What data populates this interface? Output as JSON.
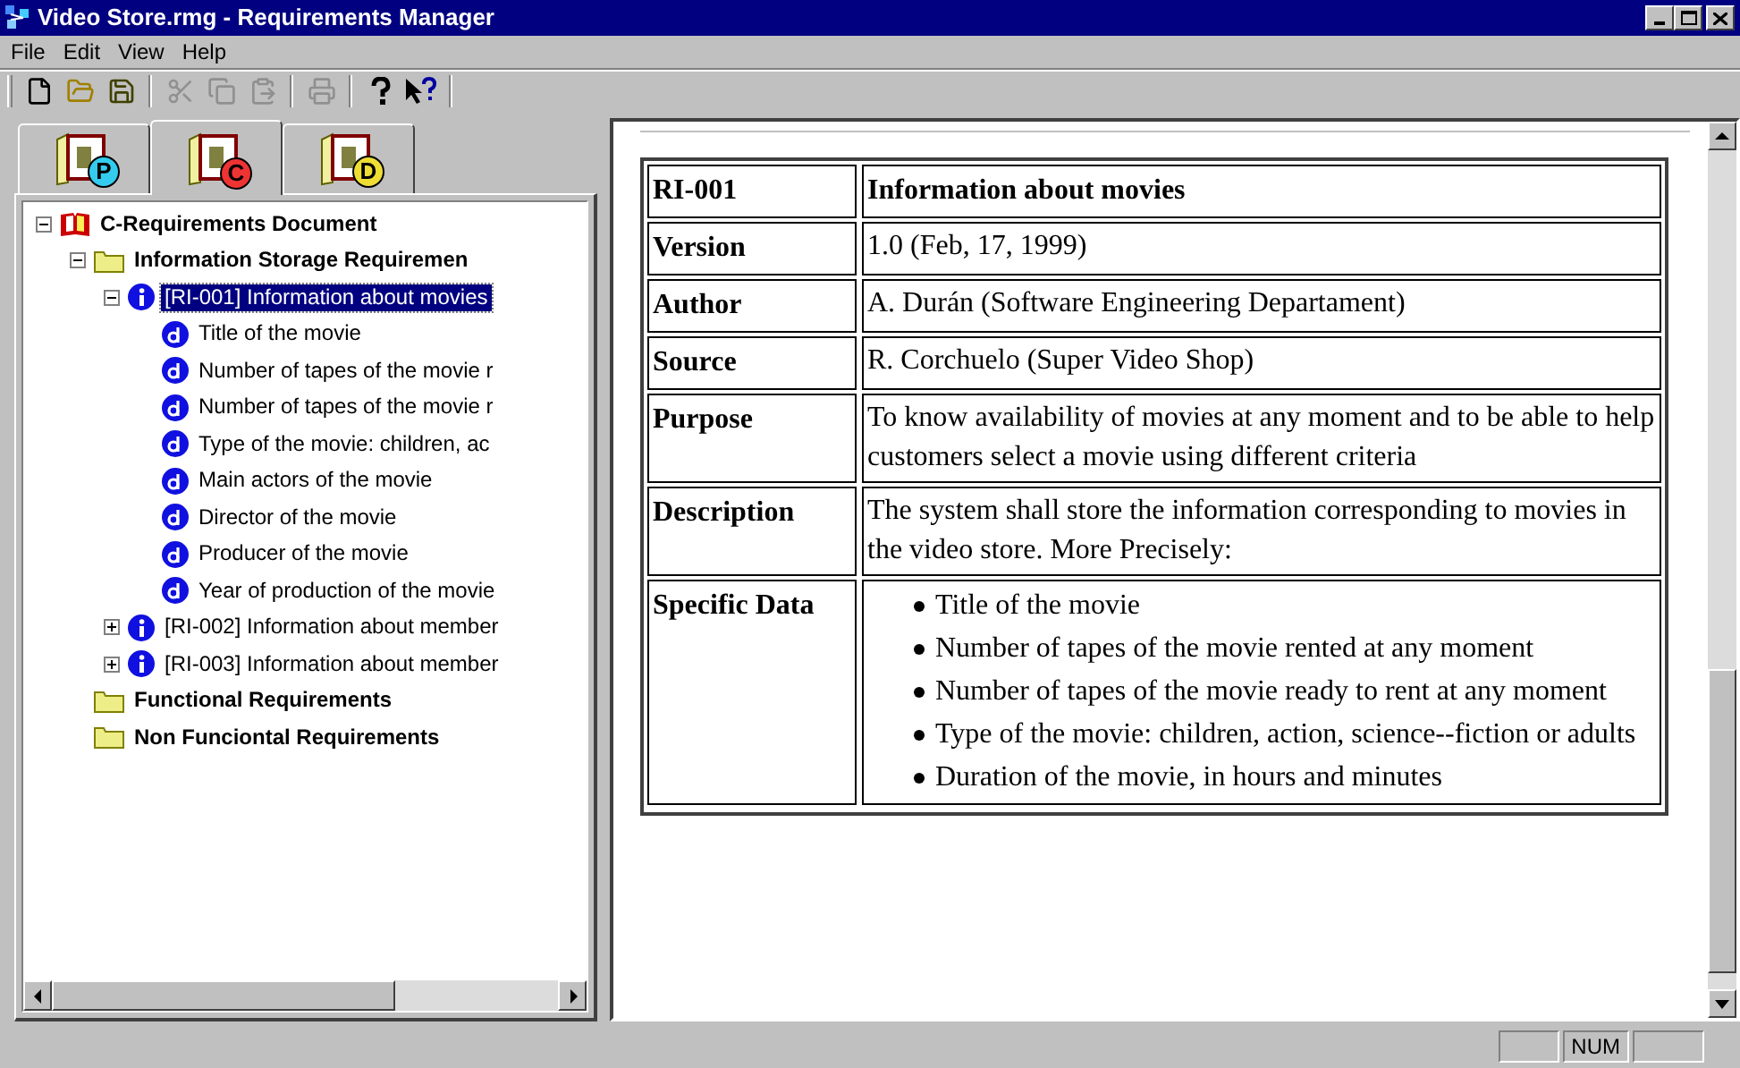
{
  "window": {
    "title": "Video Store.rmg - Requirements Manager"
  },
  "menu": [
    "File",
    "Edit",
    "View",
    "Help"
  ],
  "toolbar": [
    [
      {
        "kind": "new",
        "disabled": false
      },
      {
        "kind": "open",
        "disabled": false
      },
      {
        "kind": "save",
        "disabled": false
      }
    ],
    [
      {
        "kind": "cut",
        "disabled": true
      },
      {
        "kind": "copy",
        "disabled": true
      },
      {
        "kind": "paste",
        "disabled": true
      }
    ],
    [
      {
        "kind": "print",
        "disabled": true
      }
    ],
    [
      {
        "kind": "help",
        "disabled": false
      },
      {
        "kind": "context-help",
        "disabled": false
      }
    ]
  ],
  "tabs": [
    {
      "letter": "P",
      "color": "#33ccee",
      "selected": false
    },
    {
      "letter": "C",
      "color": "#ee3333",
      "selected": true
    },
    {
      "letter": "D",
      "color": "#eedd33",
      "selected": false
    }
  ],
  "tree": [
    {
      "kind": "document",
      "label": "C-Requirements Document",
      "expanded": true,
      "selected": false,
      "children": [
        {
          "kind": "folder",
          "label": "Information Storage Requiremen",
          "expanded": true,
          "selected": false,
          "children": [
            {
              "kind": "info",
              "label": "[RI-001] Information about movies",
              "expanded": true,
              "selected": true,
              "children": [
                {
                  "kind": "data",
                  "label": "Title of the movie",
                  "selected": false
                },
                {
                  "kind": "data",
                  "label": "Number of tapes of the movie r",
                  "selected": false
                },
                {
                  "kind": "data",
                  "label": "Number of tapes of the movie r",
                  "selected": false
                },
                {
                  "kind": "data",
                  "label": "Type of the movie: children, ac",
                  "selected": false
                },
                {
                  "kind": "data",
                  "label": "Main actors of the movie",
                  "selected": false
                },
                {
                  "kind": "data",
                  "label": "Director of the movie",
                  "selected": false
                },
                {
                  "kind": "data",
                  "label": "Producer of the movie",
                  "selected": false
                },
                {
                  "kind": "data",
                  "label": "Year of production of the movie",
                  "selected": false
                }
              ]
            },
            {
              "kind": "info",
              "label": "[RI-002] Information about member",
              "expanded": false,
              "selected": false
            },
            {
              "kind": "info",
              "label": "[RI-003] Information about member",
              "expanded": false,
              "selected": false
            }
          ]
        },
        {
          "kind": "folder",
          "label": "Functional Requirements",
          "selected": false
        },
        {
          "kind": "folder",
          "label": "Non Funciontal Requirements",
          "selected": false
        }
      ]
    }
  ],
  "table": [
    {
      "kind": "header",
      "label": "RI-001",
      "value": "Information about movies"
    },
    {
      "kind": "text",
      "label": "Version",
      "value": "1.0 (Feb, 17, 1999)"
    },
    {
      "kind": "text",
      "label": "Author",
      "value": "A. Durán (Software Engineering Departament)"
    },
    {
      "kind": "text",
      "label": "Source",
      "value": "R. Corchuelo (Super Video Shop)"
    },
    {
      "kind": "text",
      "label": "Purpose",
      "value": "To know availability of movies at any moment and to be able to help customers select a movie using different criteria"
    },
    {
      "kind": "text",
      "label": "Description",
      "value": "The system shall store the information corresponding to movies in the video store. More Precisely:"
    },
    {
      "kind": "list",
      "label": "Specific Data",
      "items": [
        "Title of the movie",
        "Number of tapes of the movie rented at any moment",
        "Number of tapes of the movie ready to rent at any moment",
        "Type of the movie: children, action, science--fiction or adults",
        "Duration of the movie, in hours and minutes"
      ]
    }
  ],
  "status_bar": {
    "indicators": [
      "NUM"
    ]
  }
}
